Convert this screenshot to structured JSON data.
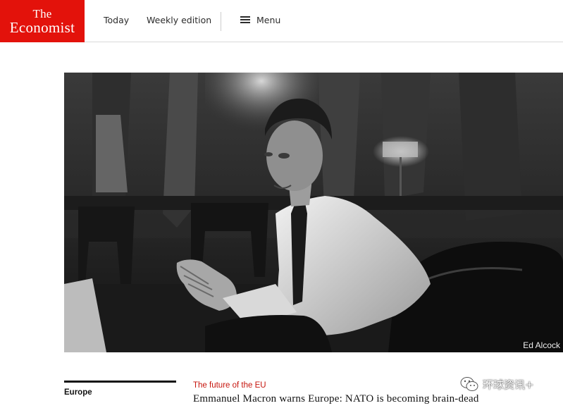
{
  "header": {
    "logo_line1": "The",
    "logo_line2": "Economist",
    "nav": {
      "today": "Today",
      "weekly": "Weekly edition",
      "menu": "Menu"
    },
    "brand_color": "#e3120b"
  },
  "hero": {
    "photo_credit": "Ed Alcock"
  },
  "article": {
    "section": "Europe",
    "flytitle": "The future of the EU",
    "headline": "Emmanuel Macron warns Europe: NATO is becoming brain-dead",
    "flytitle_color": "#c6140c"
  },
  "watermark": {
    "text": "环球资讯+"
  }
}
